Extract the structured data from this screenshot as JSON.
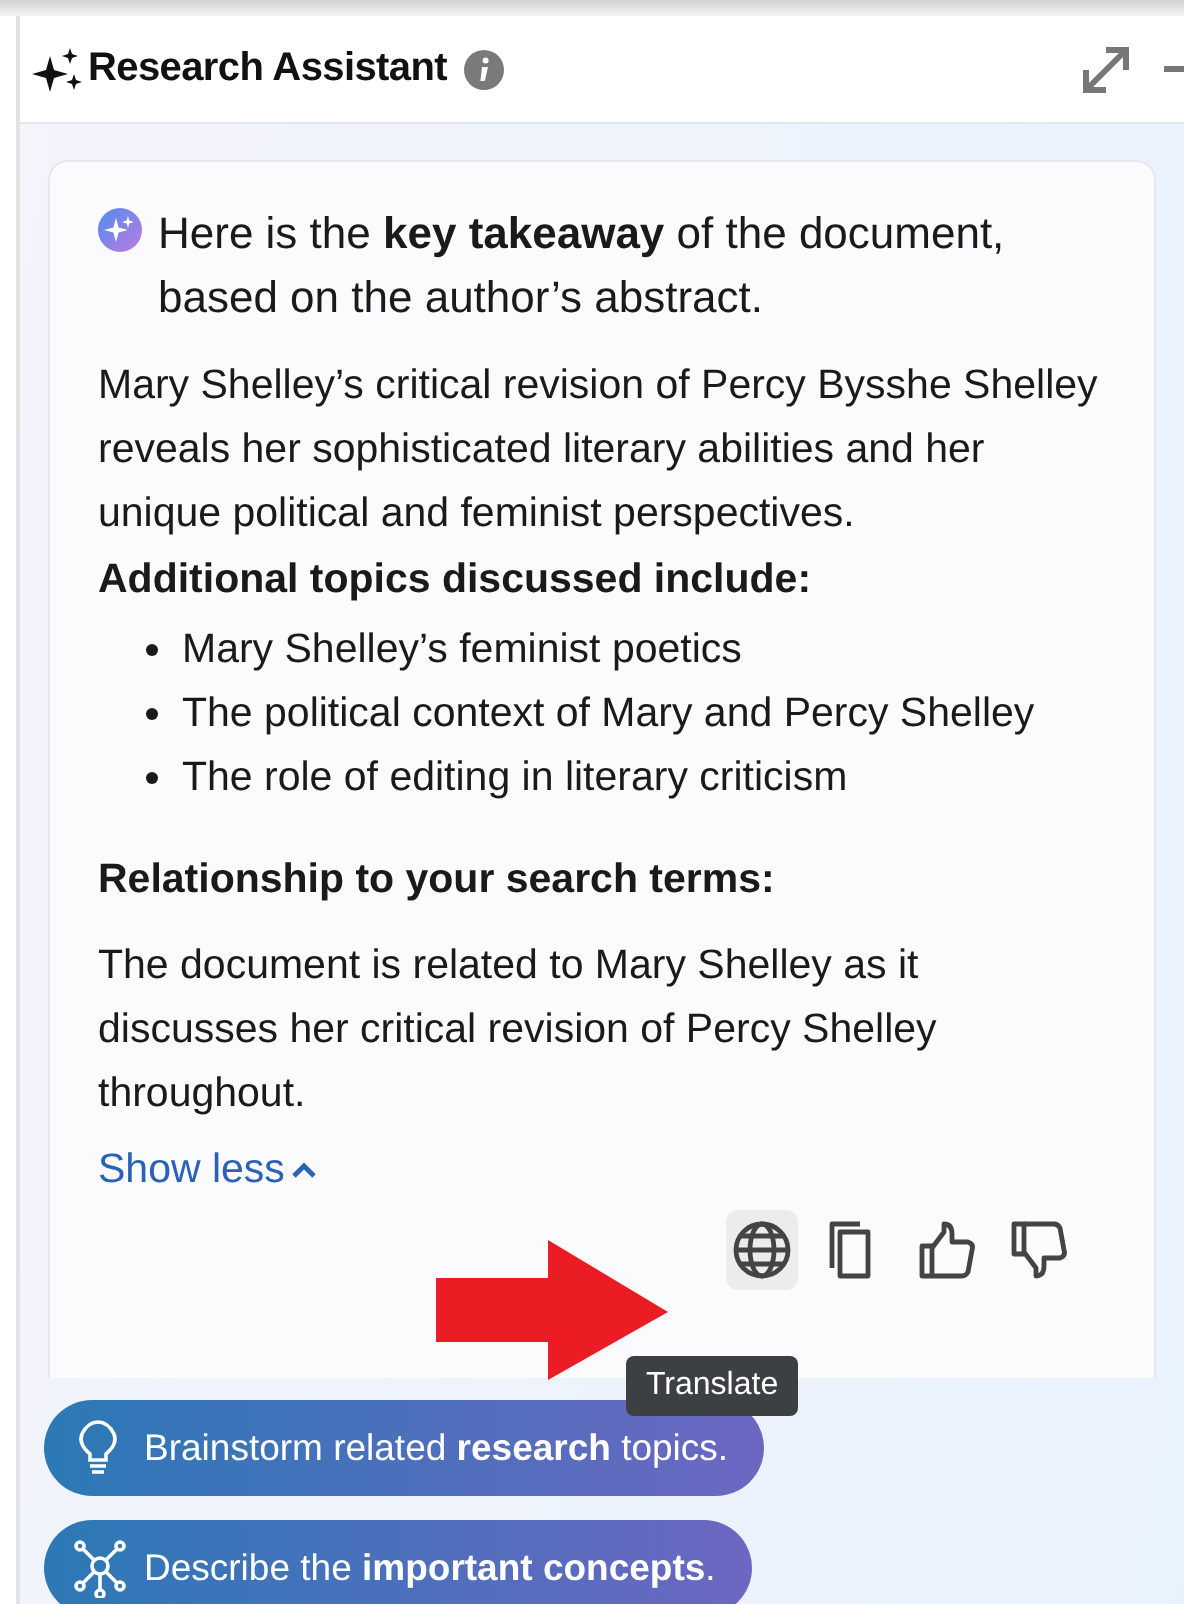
{
  "panel": {
    "title": "Research Assistant"
  },
  "card": {
    "intro": "Here is the **key takeaway** of the document, based on the author’s abstract.",
    "summary": "Mary Shelley’s critical revision of Percy Bysshe Shelley reveals her sophisticated literary abilities and her unique political and feminist perspectives.",
    "topics_heading": "Additional topics discussed include:",
    "topics": [
      "Mary Shelley’s feminist poetics",
      "The political context of Mary and Percy Shelley",
      "The role of editing in literary criticism"
    ],
    "relation_heading": "Relationship to your search terms:",
    "relation": "The document is related to Mary Shelley as it discusses her critical revision of Percy Shelley throughout.",
    "toggle": "Show less",
    "actions": [
      {
        "kind": "translate",
        "highlighted": true
      },
      {
        "kind": "copy",
        "highlighted": false
      },
      {
        "kind": "like",
        "highlighted": false
      },
      {
        "kind": "dislike",
        "highlighted": false
      }
    ]
  },
  "tooltip": {
    "text": "Translate"
  },
  "suggestions": [
    {
      "kind": "bulb",
      "text": "Brainstorm related **research** topics."
    },
    {
      "kind": "network",
      "text": "Describe the **important concepts**."
    }
  ],
  "annotations": [
    {
      "kind": "arrow",
      "color": "#ec1c24"
    }
  ]
}
